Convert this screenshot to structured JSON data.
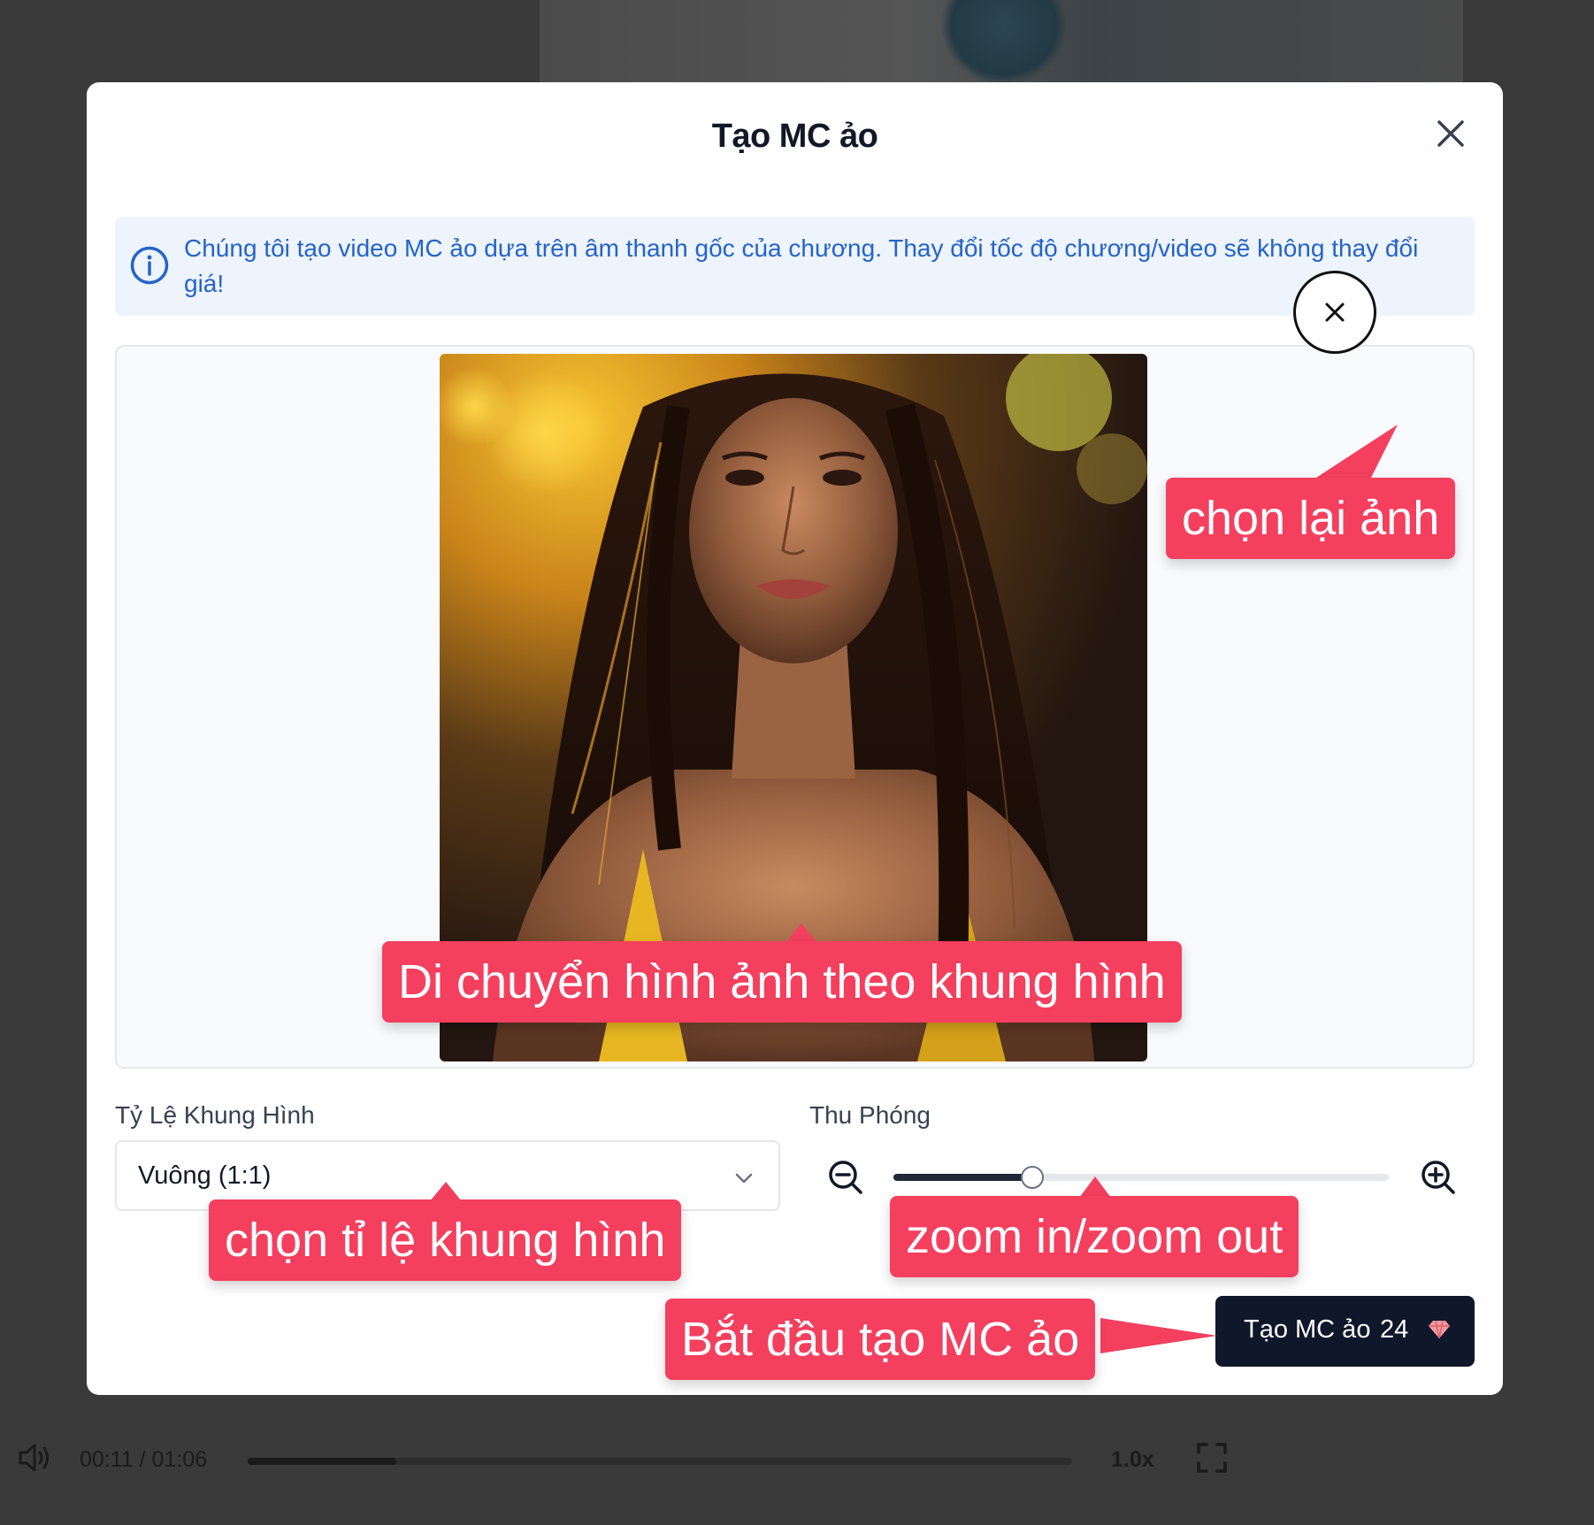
{
  "modal": {
    "title": "Tạo MC ảo",
    "info_text": "Chúng tôi tạo video MC ảo dựa trên âm thanh gốc của chương. Thay đổi tốc độ chương/video sẽ không thay đổi giá!"
  },
  "aspect_ratio": {
    "label": "Tỷ Lệ Khung Hình",
    "selected": "Vuông (1:1)"
  },
  "zoom": {
    "label": "Thu Phóng",
    "level_fraction": 0.28
  },
  "create_button": {
    "label": "Tạo MC ảo",
    "cost": "24"
  },
  "annotations": {
    "reselect_image": "chọn lại ảnh",
    "move_image": "Di chuyển hình ảnh theo khung hình",
    "choose_ratio": "chọn tỉ lệ khung hình",
    "zoom": "zoom in/zoom out",
    "start": "Bắt đầu tạo MC ảo"
  },
  "player": {
    "time": "00:11 / 01:06",
    "progress_fraction": 0.18,
    "speed": "1.0x"
  },
  "colors": {
    "accent_callout": "#f43f5e",
    "info_bg": "#eef4fd",
    "info_text": "#2563c9",
    "primary_button": "#0f172a"
  },
  "icons": [
    "close-icon",
    "info-icon",
    "chevron-down-icon",
    "zoom-out-icon",
    "zoom-in-icon",
    "gem-icon",
    "volume-icon",
    "fullscreen-icon"
  ]
}
